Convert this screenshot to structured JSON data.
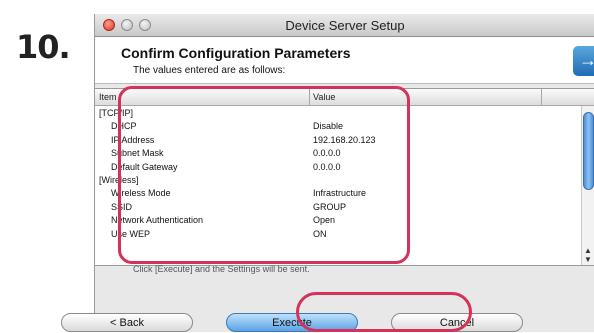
{
  "step_number": "10.",
  "window": {
    "title": "Device Server Setup"
  },
  "header": {
    "title": "Confirm Configuration Parameters",
    "subtitle": "The values entered are as follows:"
  },
  "table": {
    "columns": [
      "Item",
      "Value"
    ],
    "rows": [
      {
        "item": "[TCP/IP]",
        "value": "",
        "indent": false
      },
      {
        "item": "DHCP",
        "value": "Disable",
        "indent": true
      },
      {
        "item": "IP Address",
        "value": "192.168.20.123",
        "indent": true
      },
      {
        "item": "Subnet Mask",
        "value": "0.0.0.0",
        "indent": true
      },
      {
        "item": "Default Gateway",
        "value": "0.0.0.0",
        "indent": true
      },
      {
        "item": "[Wireless]",
        "value": "",
        "indent": false
      },
      {
        "item": "Wireless Mode",
        "value": "Infrastructure",
        "indent": true
      },
      {
        "item": "SSID",
        "value": "GROUP",
        "indent": true
      },
      {
        "item": "Network Authentication",
        "value": "Open",
        "indent": true
      },
      {
        "item": "Use WEP",
        "value": "ON",
        "indent": true
      }
    ]
  },
  "note": "Click [Execute] and the Settings will be sent.",
  "buttons": {
    "back": "< Back",
    "execute": "Execute",
    "cancel": "Cancel"
  },
  "colors": {
    "highlight": "#d6315a",
    "execute_button": "#5aa3e6"
  }
}
